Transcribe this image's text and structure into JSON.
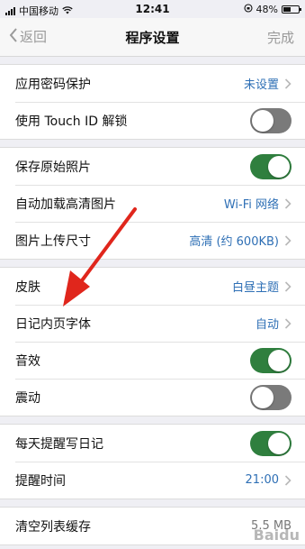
{
  "status_bar": {
    "carrier": "中国移动",
    "time": "12:41",
    "battery": "48%"
  },
  "nav": {
    "back_label": "返回",
    "title": "程序设置",
    "done_label": "完成"
  },
  "groups": [
    {
      "rows": [
        {
          "label": "应用密码保护",
          "value": "未设置",
          "control": "chevron"
        },
        {
          "label": "使用 Touch ID 解锁",
          "control": "toggle",
          "on": false
        }
      ]
    },
    {
      "rows": [
        {
          "label": "保存原始照片",
          "control": "toggle",
          "on": true
        },
        {
          "label": "自动加载高清图片",
          "value": "Wi-Fi 网络",
          "control": "chevron"
        },
        {
          "label": "图片上传尺寸",
          "value": "高清 (约 600KB)",
          "control": "chevron"
        }
      ]
    },
    {
      "rows": [
        {
          "label": "皮肤",
          "value": "白昼主题",
          "control": "chevron"
        },
        {
          "label": "日记内页字体",
          "value": "自动",
          "control": "chevron"
        },
        {
          "label": "音效",
          "control": "toggle",
          "on": true
        },
        {
          "label": "震动",
          "control": "toggle",
          "on": false
        }
      ]
    },
    {
      "rows": [
        {
          "label": "每天提醒写日记",
          "control": "toggle",
          "on": true
        },
        {
          "label": "提醒时间",
          "value": "21:00",
          "control": "chevron"
        }
      ]
    },
    {
      "rows": [
        {
          "label": "清空列表缓存",
          "value": "5.5 MB",
          "control": "value"
        }
      ]
    }
  ],
  "colors": {
    "accent_blue": "#2e6fb5",
    "toggle_on": "#2f7f3e",
    "toggle_off": "#7a7a7a",
    "annotation_red": "#e0261c"
  },
  "watermark": "Baidu"
}
